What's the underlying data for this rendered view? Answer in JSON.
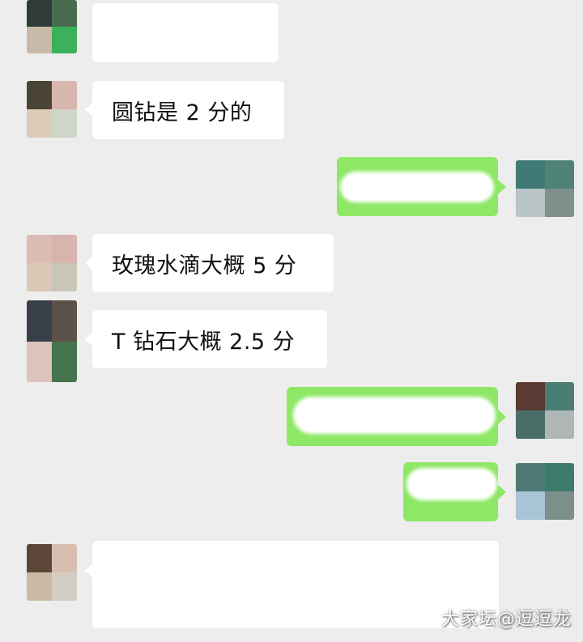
{
  "chat": {
    "messages": [
      {
        "side": "left",
        "text": ""
      },
      {
        "side": "left",
        "text": "圆钻是 2 分的"
      },
      {
        "side": "right",
        "text": ""
      },
      {
        "side": "left",
        "text": "玫瑰水滴大概 5 分"
      },
      {
        "side": "left",
        "text": "T 钻石大概 2.5 分"
      },
      {
        "side": "right",
        "text": ""
      },
      {
        "side": "right",
        "text": ""
      },
      {
        "side": "left",
        "text": ""
      }
    ]
  },
  "watermark": "大家坛@逗逗龙",
  "colors": {
    "background": "#ededed",
    "incoming_bubble": "#ffffff",
    "outgoing_bubble": "#8ee866"
  }
}
